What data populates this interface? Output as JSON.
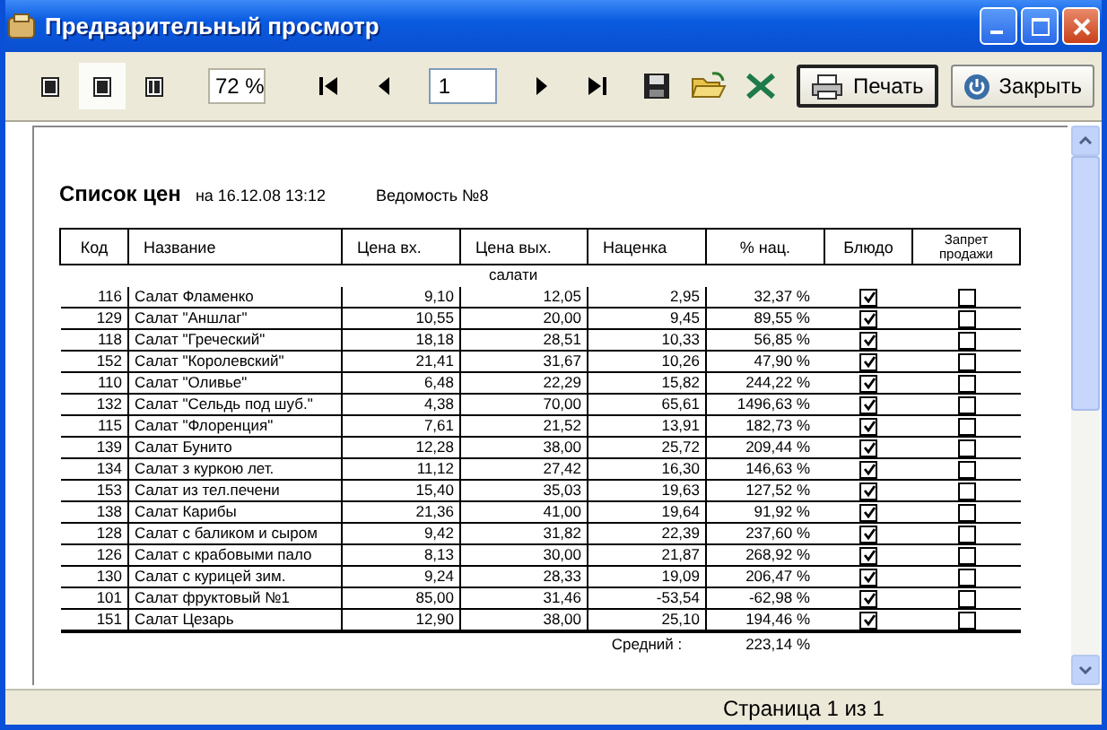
{
  "window": {
    "title": "Предварительный просмотр"
  },
  "toolbar": {
    "view_modes": [
      {
        "selected": false
      },
      {
        "selected": true
      },
      {
        "selected": false
      }
    ],
    "zoom": "72 %",
    "page": "1",
    "print_button": "Печать",
    "close_button": "Закрыть"
  },
  "report": {
    "title": "Список цен",
    "date": "на 16.12.08  13:12",
    "document": "Ведомость №8",
    "columns": [
      "Код",
      "Название",
      "Цена вх.",
      "Цена вых.",
      "Наценка",
      "% нац.",
      "Блюдо",
      "Запрет продажи"
    ],
    "group": "салати",
    "rows": [
      {
        "code": "116",
        "name": "Салат  Фламенко",
        "price_in": "9,10",
        "price_out": "12,05",
        "markup": "2,95",
        "markup_pct": "32,37  %",
        "dish": true,
        "sale_ban": false
      },
      {
        "code": "129",
        "name": "Салат \"Аншлаг\"",
        "price_in": "10,55",
        "price_out": "20,00",
        "markup": "9,45",
        "markup_pct": "89,55  %",
        "dish": true,
        "sale_ban": false
      },
      {
        "code": "118",
        "name": "Салат \"Греческий\"",
        "price_in": "18,18",
        "price_out": "28,51",
        "markup": "10,33",
        "markup_pct": "56,85  %",
        "dish": true,
        "sale_ban": false
      },
      {
        "code": "152",
        "name": "Салат \"Королевский\"",
        "price_in": "21,41",
        "price_out": "31,67",
        "markup": "10,26",
        "markup_pct": "47,90  %",
        "dish": true,
        "sale_ban": false
      },
      {
        "code": "110",
        "name": "Салат \"Оливье\"",
        "price_in": "6,48",
        "price_out": "22,29",
        "markup": "15,82",
        "markup_pct": "244,22  %",
        "dish": true,
        "sale_ban": false
      },
      {
        "code": "132",
        "name": "Салат \"Сельдь под шуб.\"",
        "price_in": "4,38",
        "price_out": "70,00",
        "markup": "65,61",
        "markup_pct": "1496,63  %",
        "dish": true,
        "sale_ban": false
      },
      {
        "code": "115",
        "name": "Салат \"Флоренция\"",
        "price_in": "7,61",
        "price_out": "21,52",
        "markup": "13,91",
        "markup_pct": "182,73  %",
        "dish": true,
        "sale_ban": false
      },
      {
        "code": "139",
        "name": "Салат Бунито",
        "price_in": "12,28",
        "price_out": "38,00",
        "markup": "25,72",
        "markup_pct": "209,44  %",
        "dish": true,
        "sale_ban": false
      },
      {
        "code": "134",
        "name": "Салат з куркою лет.",
        "price_in": "11,12",
        "price_out": "27,42",
        "markup": "16,30",
        "markup_pct": "146,63  %",
        "dish": true,
        "sale_ban": false
      },
      {
        "code": "153",
        "name": "Салат из тел.печени",
        "price_in": "15,40",
        "price_out": "35,03",
        "markup": "19,63",
        "markup_pct": "127,52  %",
        "dish": true,
        "sale_ban": false
      },
      {
        "code": "138",
        "name": "Салат Карибы",
        "price_in": "21,36",
        "price_out": "41,00",
        "markup": "19,64",
        "markup_pct": "91,92  %",
        "dish": true,
        "sale_ban": false
      },
      {
        "code": "128",
        "name": "Салат с баликом и сыром",
        "price_in": "9,42",
        "price_out": "31,82",
        "markup": "22,39",
        "markup_pct": "237,60  %",
        "dish": true,
        "sale_ban": false
      },
      {
        "code": "126",
        "name": "Салат с крабовыми пало",
        "price_in": "8,13",
        "price_out": "30,00",
        "markup": "21,87",
        "markup_pct": "268,92  %",
        "dish": true,
        "sale_ban": false
      },
      {
        "code": "130",
        "name": "Салат с курицей зим.",
        "price_in": "9,24",
        "price_out": "28,33",
        "markup": "19,09",
        "markup_pct": "206,47  %",
        "dish": true,
        "sale_ban": false
      },
      {
        "code": "101",
        "name": "Салат фруктовый №1",
        "price_in": "85,00",
        "price_out": "31,46",
        "markup": "-53,54",
        "markup_pct": "-62,98  %",
        "dish": true,
        "sale_ban": false
      },
      {
        "code": "151",
        "name": "Салат Цезарь",
        "price_in": "12,90",
        "price_out": "38,00",
        "markup": "25,10",
        "markup_pct": "194,46  %",
        "dish": true,
        "sale_ban": false
      }
    ],
    "average_label": "Средний :",
    "average_value": "223,14  %"
  },
  "status_bar": {
    "page_info": "Страница 1 из 1"
  }
}
